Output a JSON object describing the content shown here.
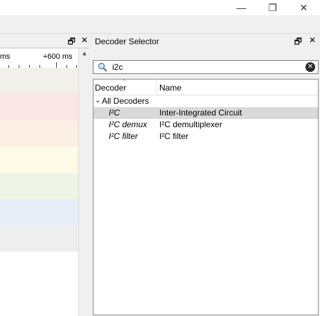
{
  "window": {
    "minimize_glyph": "—",
    "restore_glyph": "❐",
    "close_glyph": "✕"
  },
  "left_dock": {
    "dock_float_glyph": "🗗",
    "dock_close_glyph": "✕",
    "ruler_left_label": "ms",
    "ruler_right_label": "+600 ms",
    "trace_colors": [
      "#f2f0ea",
      "#fbe6e6",
      "#fcefe3",
      "#fdfbe6",
      "#eef5e6",
      "#e8eef7",
      "#eeeeee"
    ]
  },
  "decoder_selector": {
    "title": "Decoder Selector",
    "dock_float_glyph": "🗗",
    "dock_close_glyph": "✕",
    "search": {
      "value": "i2c",
      "clear_glyph": "✕"
    },
    "columns": {
      "decoder": "Decoder",
      "name": "Name"
    },
    "group": {
      "label": "All Decoders",
      "expander_glyph": "⌄"
    },
    "items": [
      {
        "decoder": "I²C",
        "name": "Inter-Integrated Circuit",
        "selected": true
      },
      {
        "decoder": "I²C demux",
        "name": "I²C demultiplexer",
        "selected": false
      },
      {
        "decoder": "I²C filter",
        "name": "I²C filter",
        "selected": false
      }
    ]
  }
}
